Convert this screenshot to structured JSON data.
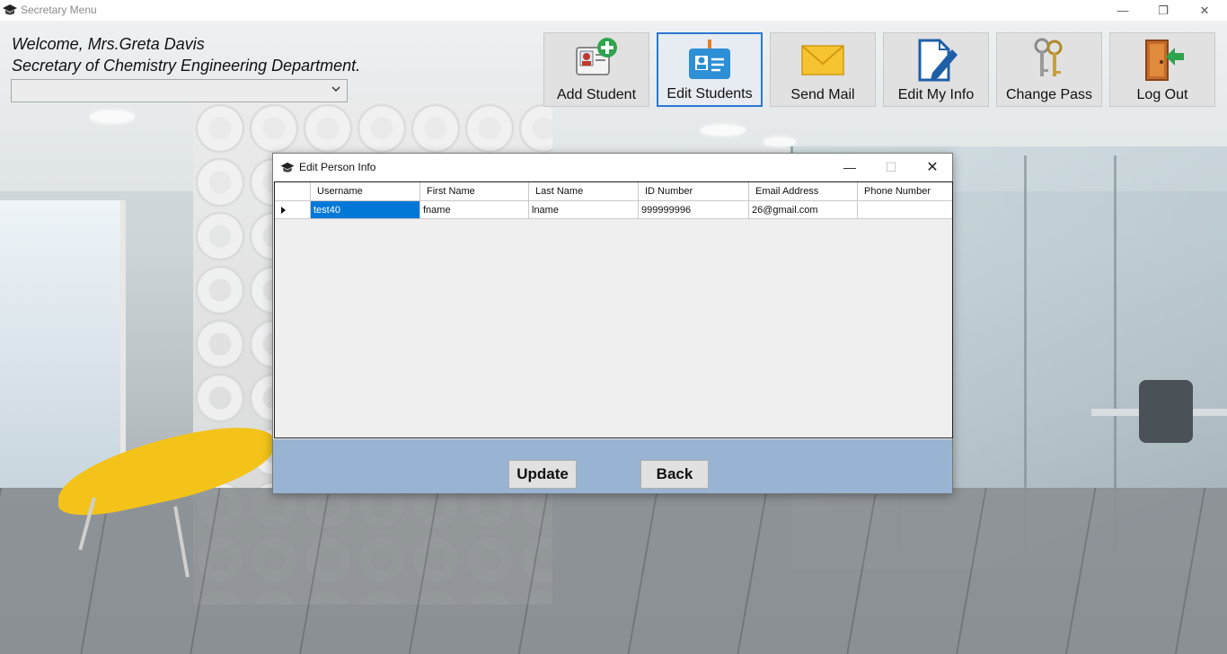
{
  "window": {
    "title": "Secretary Menu",
    "minimize_glyph": "—",
    "maximize_glyph": "❐",
    "close_glyph": "✕"
  },
  "header": {
    "welcome_line": "Welcome, Mrs.Greta Davis",
    "role_line": "Secretary of Chemistry Engineering Department.",
    "combo_value": ""
  },
  "toolbar": {
    "tiles": [
      {
        "label": "Add Student",
        "icon": "add-student-icon"
      },
      {
        "label": "Edit Students",
        "icon": "id-badge-icon",
        "active": true
      },
      {
        "label": "Send Mail",
        "icon": "envelope-icon"
      },
      {
        "label": "Edit My Info",
        "icon": "edit-document-icon"
      },
      {
        "label": "Change Pass",
        "icon": "keys-icon"
      },
      {
        "label": "Log Out",
        "icon": "exit-door-icon"
      }
    ]
  },
  "dialog": {
    "title": "Edit Person Info",
    "minimize_glyph": "—",
    "maximize_glyph": "☐",
    "close_glyph": "✕",
    "grid": {
      "columns": [
        "Username",
        "First Name",
        "Last Name",
        "ID Number",
        "Email Address",
        "Phone Number"
      ],
      "rows": [
        {
          "username": "test40",
          "first_name": "fname",
          "last_name": "lname",
          "id_number": "999999996",
          "email": "26@gmail.com",
          "phone": ""
        }
      ]
    },
    "buttons": {
      "update": "Update",
      "back": "Back"
    }
  },
  "colors": {
    "accent": "#2b78d4",
    "selection": "#0078d7",
    "footer": "#98b4d2"
  }
}
